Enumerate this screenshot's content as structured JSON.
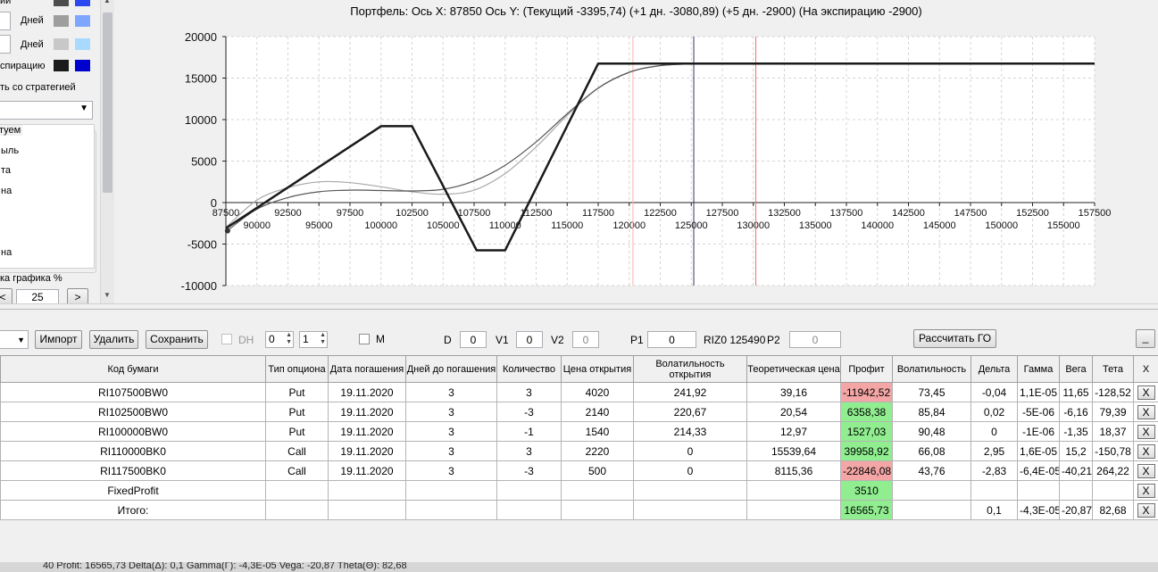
{
  "left_panel": {
    "row1_label": "ии",
    "row2_value": "",
    "row2_label": "Дней",
    "row3_value": "",
    "row3_label": "Дней",
    "row4_label": "спирацию",
    "strategy_label": "ть со стратегией",
    "group_title": "туем",
    "radio_items": [
      "ыль",
      "та",
      "на",
      "",
      "на"
    ],
    "scale_label": "ка графика %",
    "scale_value": "25",
    "prev_button": "<",
    "next_button": ">",
    "swatch_colors": [
      [
        "#4d4d4d",
        "#2a49f0"
      ],
      [
        "#9e9e9e",
        "#7fa6ff"
      ],
      [
        "#c8c8c8",
        "#a8daff"
      ],
      [
        "#1a1a1a",
        "#0000cc"
      ]
    ]
  },
  "chart_title": "Портфель: Ось X: 87850 Ось Y:  (Текущий -3395,74)  (+1 дн. -3080,89)  (+5 дн. -2900)  (На экспирацию -2900)",
  "chart_data": {
    "type": "line",
    "title": "Портфель: Ось X: 87850 Ось Y:  (Текущий -3395,74)  (+1 дн. -3080,89)  (+5 дн. -2900)  (На экспирацию -2900)",
    "xlim": [
      87500,
      157500
    ],
    "ylim": [
      -10000,
      20000
    ],
    "x_ticks_top": [
      "87500",
      "92500",
      "97500",
      "102500",
      "107500",
      "112500",
      "117500",
      "122500",
      "127500",
      "132500",
      "137500",
      "142500",
      "147500",
      "152500",
      "157500"
    ],
    "x_ticks_bottom": [
      "90000",
      "95000",
      "100000",
      "105000",
      "110000",
      "115000",
      "120000",
      "125000",
      "130000",
      "135000",
      "140000",
      "145000",
      "150000",
      "155000"
    ],
    "y_ticks": [
      "20000",
      "15000",
      "10000",
      "5000",
      "0",
      "-5000",
      "-10000"
    ],
    "grid": true,
    "vertical_lines": [
      {
        "x": 120300,
        "color": "#ffb0b0"
      },
      {
        "x": 125200,
        "color": "#33336b"
      },
      {
        "x": 130200,
        "color": "#ff6b6b"
      }
    ],
    "series": [
      {
        "color": "#1a1a1a",
        "width": 2.5,
        "x": [
          87500,
          100000,
          102500,
          107700,
          110000,
          117500,
          157500
        ],
        "y": [
          -3100,
          9200,
          9200,
          -5750,
          -5750,
          16750,
          16750
        ]
      },
      {
        "color": "#555555",
        "width": 1.2,
        "x": [
          87500,
          90000,
          92500,
          95000,
          97500,
          100000,
          102500,
          105000,
          107500,
          110000,
          112500,
          115000,
          117500,
          120000,
          122500,
          125000,
          127500,
          130000
        ],
        "y": [
          -3500,
          -800,
          600,
          1300,
          1500,
          1450,
          1400,
          1600,
          2600,
          4500,
          7300,
          10700,
          13800,
          15700,
          16500,
          16700,
          16750,
          16750
        ]
      },
      {
        "color": "#a8a8a8",
        "width": 1.2,
        "x": [
          87500,
          90000,
          92500,
          95000,
          97500,
          100000,
          102500,
          105000,
          107500,
          110000,
          112500,
          115000,
          117500,
          120000,
          122500,
          125000,
          127500,
          130000
        ],
        "y": [
          -3000,
          300,
          1800,
          2500,
          2400,
          1900,
          1300,
          1000,
          1500,
          3500,
          6700,
          10500,
          13800,
          15700,
          16500,
          16700,
          16750,
          16750
        ]
      }
    ]
  },
  "toolbar": {
    "import_label": "Импорт",
    "delete_label": "Удалить",
    "save_label": "Сохранить",
    "dh_label": "DH",
    "spin1_value": "0",
    "spin2_value": "1",
    "m_label": "M",
    "d_label": "D",
    "d_value": "0",
    "v1_label": "V1",
    "v1_value": "0",
    "v2_label": "V2",
    "v2_value": "0",
    "p1_label": "P1",
    "p1_value": "0",
    "riz_label": "RIZ0 125490",
    "p2_label": "P2",
    "p2_value": "0",
    "calc_label": "Рассчитать ГО",
    "minimize_label": "_"
  },
  "table": {
    "headers": [
      "Код бумаги",
      "Тип опциона",
      "Дата погашения",
      "Дней до погашения",
      "Количество",
      "Цена открытия",
      "Волатильность открытия",
      "Теоретическая цена",
      "Профит",
      "Волатильность",
      "Дельта",
      "Гамма",
      "Вега",
      "Тета",
      "X"
    ],
    "rows": [
      {
        "cells": [
          "RI107500BW0",
          "Put",
          "19.11.2020",
          "3",
          "3",
          "4020",
          "241,92",
          "39,16",
          "-11942,52",
          "73,45",
          "-0,04",
          "1,1E-05",
          "11,65",
          "-128,52"
        ],
        "profit": "neg"
      },
      {
        "cells": [
          "RI102500BW0",
          "Put",
          "19.11.2020",
          "3",
          "-3",
          "2140",
          "220,67",
          "20,54",
          "6358,38",
          "85,84",
          "0,02",
          "-5E-06",
          "-6,16",
          "79,39"
        ],
        "profit": "pos"
      },
      {
        "cells": [
          "RI100000BW0",
          "Put",
          "19.11.2020",
          "3",
          "-1",
          "1540",
          "214,33",
          "12,97",
          "1527,03",
          "90,48",
          "0",
          "-1E-06",
          "-1,35",
          "18,37"
        ],
        "profit": "pos"
      },
      {
        "cells": [
          "RI110000BK0",
          "Call",
          "19.11.2020",
          "3",
          "3",
          "2220",
          "0",
          "15539,64",
          "39958,92",
          "66,08",
          "2,95",
          "1,6E-05",
          "15,2",
          "-150,78"
        ],
        "profit": "pos"
      },
      {
        "cells": [
          "RI117500BK0",
          "Call",
          "19.11.2020",
          "3",
          "-3",
          "500",
          "0",
          "8115,36",
          "-22846,08",
          "43,76",
          "-2,83",
          "-6,4E-05",
          "-40,21",
          "264,22"
        ],
        "profit": "neg"
      },
      {
        "cells": [
          "FixedProfit",
          "",
          "",
          "",
          "",
          "",
          "",
          "",
          "3510",
          "",
          "",
          "",
          "",
          ""
        ],
        "profit": "pos"
      },
      {
        "cells": [
          "Итого:",
          "",
          "",
          "",
          "",
          "",
          "",
          "",
          "16565,73",
          "",
          "0,1",
          "-4,3E-05",
          "-20,87",
          "82,68"
        ],
        "profit": "pos"
      }
    ],
    "delete_label": "X"
  },
  "status": {
    "text": "40       Profit: 16565,73 Delta(Δ): 0,1 Gamma(Γ): -4,3E-05 Vega: -20,87 Theta(Θ): 82,68"
  }
}
